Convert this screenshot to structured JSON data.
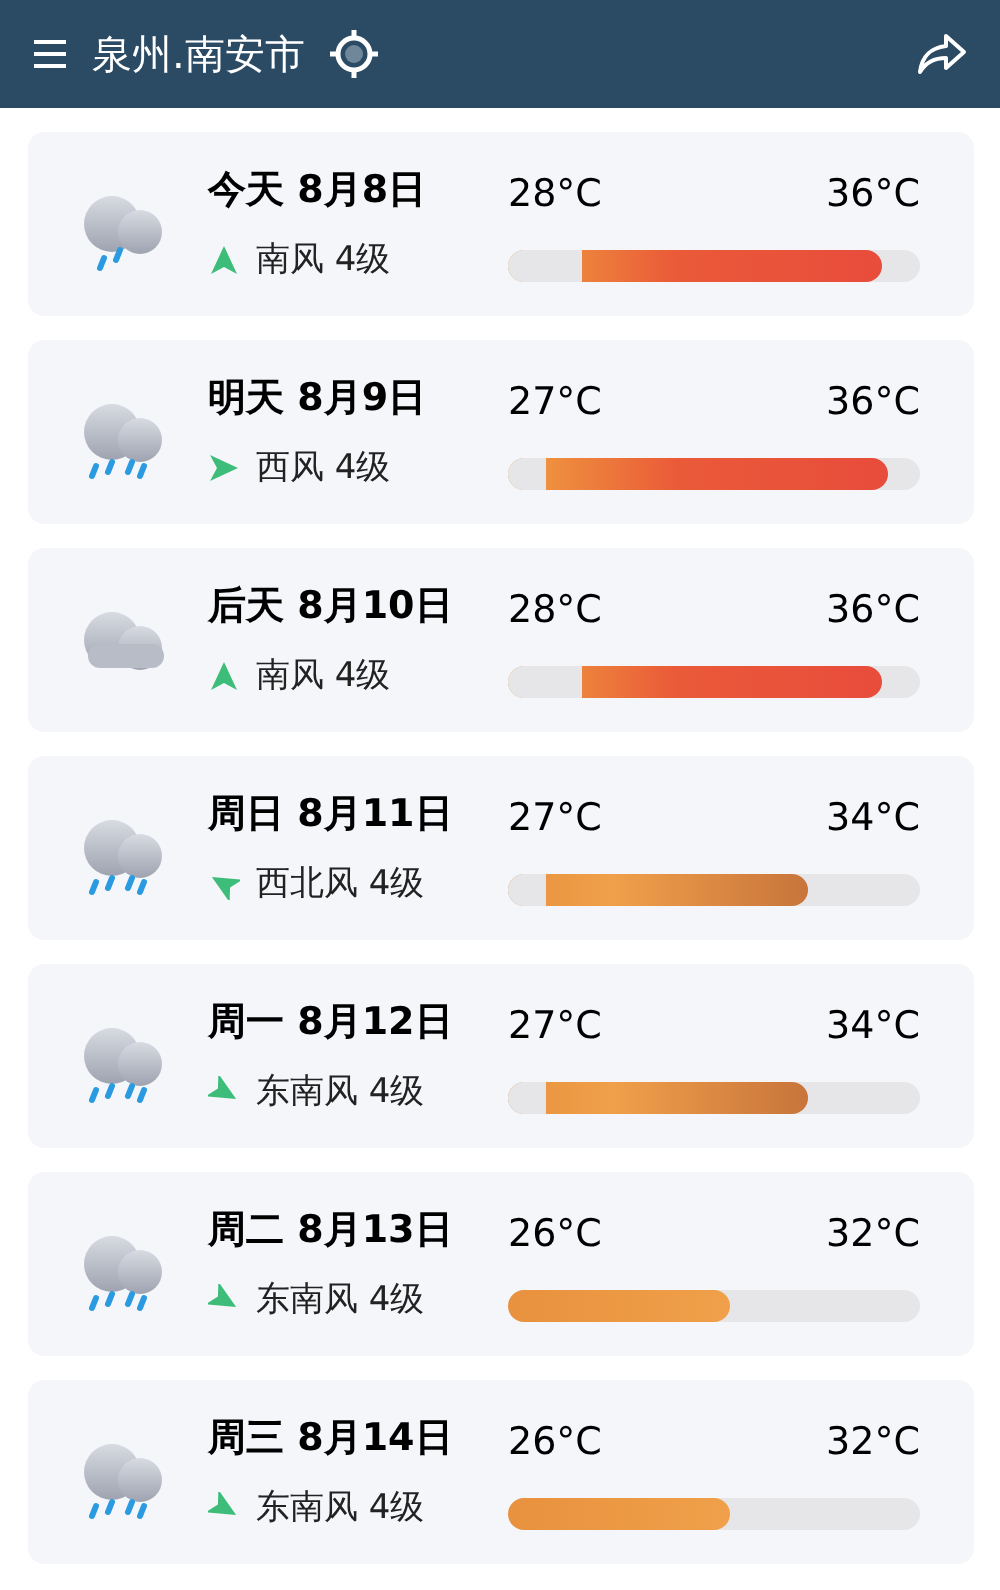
{
  "header": {
    "city": "泉州.南安市"
  },
  "days": [
    {
      "date": "今天 8月8日",
      "weather_icon": {
        "kind": "light-rain"
      },
      "wind": {
        "text": "南风 4级",
        "arrow": {
          "kind": "up"
        }
      },
      "low": "28°C",
      "high": "36°C",
      "bar": {
        "kind": "hot",
        "level": 0.91,
        "start": {
          "level": 0.18
        }
      }
    },
    {
      "date": "明天 8月9日",
      "weather_icon": {
        "kind": "rain"
      },
      "wind": {
        "text": "西风 4级",
        "arrow": {
          "kind": "right"
        }
      },
      "low": "27°C",
      "high": "36°C",
      "bar": {
        "kind": "hot",
        "level": 0.92,
        "start": {
          "level": 0.09
        }
      }
    },
    {
      "date": "后天 8月10日",
      "weather_icon": {
        "kind": "cloudy"
      },
      "wind": {
        "text": "南风 4级",
        "arrow": {
          "kind": "up"
        }
      },
      "low": "28°C",
      "high": "36°C",
      "bar": {
        "kind": "hot",
        "level": 0.91,
        "start": {
          "level": 0.18
        }
      }
    },
    {
      "date": "周日 8月11日",
      "weather_icon": {
        "kind": "rain"
      },
      "wind": {
        "text": "西北风 4级",
        "arrow": {
          "kind": "up-left"
        }
      },
      "low": "27°C",
      "high": "34°C",
      "bar": {
        "kind": "warm",
        "level": 0.73,
        "start": {
          "level": 0.09
        }
      }
    },
    {
      "date": "周一 8月12日",
      "weather_icon": {
        "kind": "rain"
      },
      "wind": {
        "text": "东南风 4级",
        "arrow": {
          "kind": "down-right"
        }
      },
      "low": "27°C",
      "high": "34°C",
      "bar": {
        "kind": "warm",
        "level": 0.73,
        "start": {
          "level": 0.09
        }
      }
    },
    {
      "date": "周二 8月13日",
      "weather_icon": {
        "kind": "rain"
      },
      "wind": {
        "text": "东南风 4级",
        "arrow": {
          "kind": "down-right"
        }
      },
      "low": "26°C",
      "high": "32°C",
      "bar": {
        "kind": "mild",
        "level": 0.54
      }
    },
    {
      "date": "周三 8月14日",
      "weather_icon": {
        "kind": "rain"
      },
      "wind": {
        "text": "东南风 4级",
        "arrow": {
          "kind": "down-right"
        }
      },
      "low": "26°C",
      "high": "32°C",
      "bar": {
        "kind": "mild",
        "level": 0.54
      }
    }
  ]
}
